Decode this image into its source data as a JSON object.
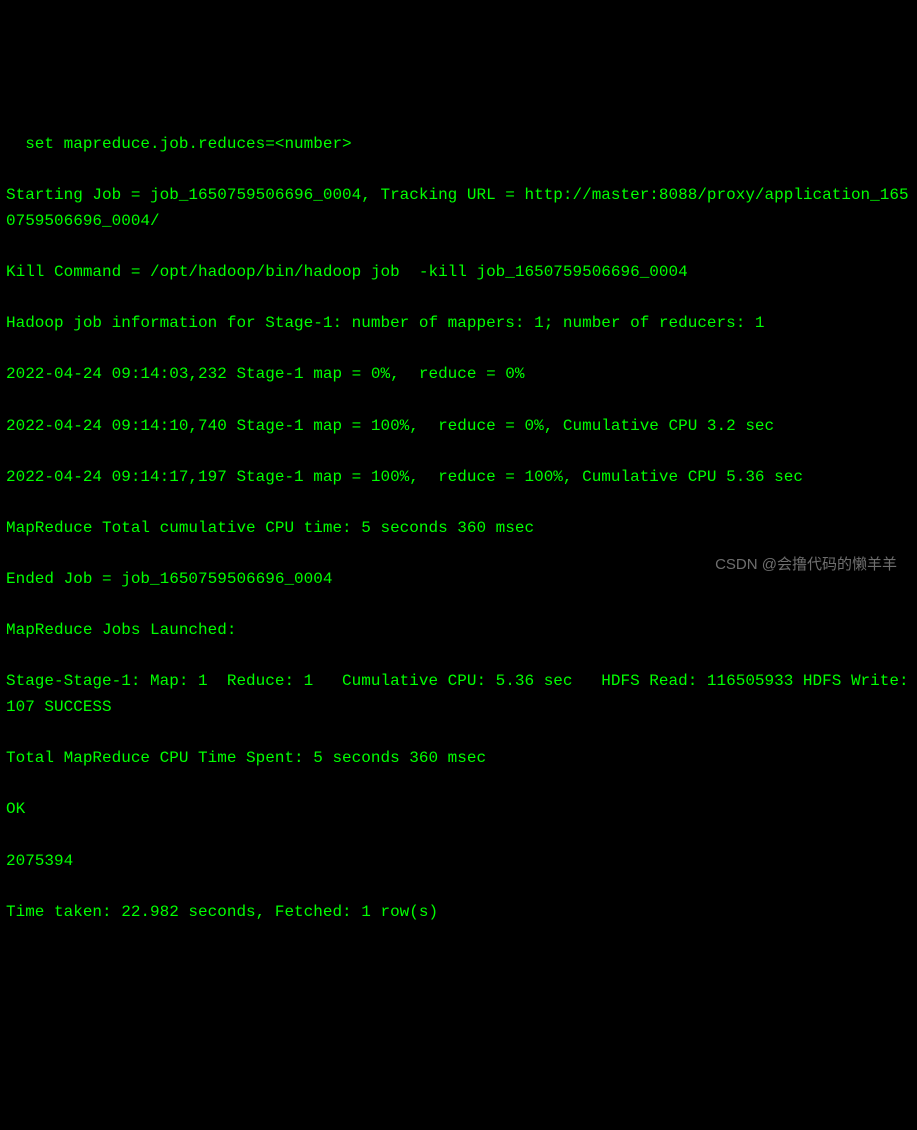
{
  "terminal": {
    "lines": [
      "  set mapreduce.job.reduces=<number>",
      "Starting Job = job_1650759506696_0004, Tracking URL = http://master:8088/proxy/application_1650759506696_0004/",
      "Kill Command = /opt/hadoop/bin/hadoop job  -kill job_1650759506696_0004",
      "Hadoop job information for Stage-1: number of mappers: 1; number of reducers: 1",
      "2022-04-24 09:14:03,232 Stage-1 map = 0%,  reduce = 0%",
      "2022-04-24 09:14:10,740 Stage-1 map = 100%,  reduce = 0%, Cumulative CPU 3.2 sec",
      "2022-04-24 09:14:17,197 Stage-1 map = 100%,  reduce = 100%, Cumulative CPU 5.36 sec",
      "MapReduce Total cumulative CPU time: 5 seconds 360 msec",
      "Ended Job = job_1650759506696_0004",
      "MapReduce Jobs Launched:",
      "Stage-Stage-1: Map: 1  Reduce: 1   Cumulative CPU: 5.36 sec   HDFS Read: 116505933 HDFS Write: 107 SUCCESS",
      "Total MapReduce CPU Time Spent: 5 seconds 360 msec",
      "OK",
      "2075394",
      "Time taken: 22.982 seconds, Fetched: 1 row(s)"
    ]
  },
  "watermark": {
    "text": "CSDN @会撸代码的懒羊羊"
  },
  "colors": {
    "background": "#000000",
    "foreground": "#00ff00"
  }
}
